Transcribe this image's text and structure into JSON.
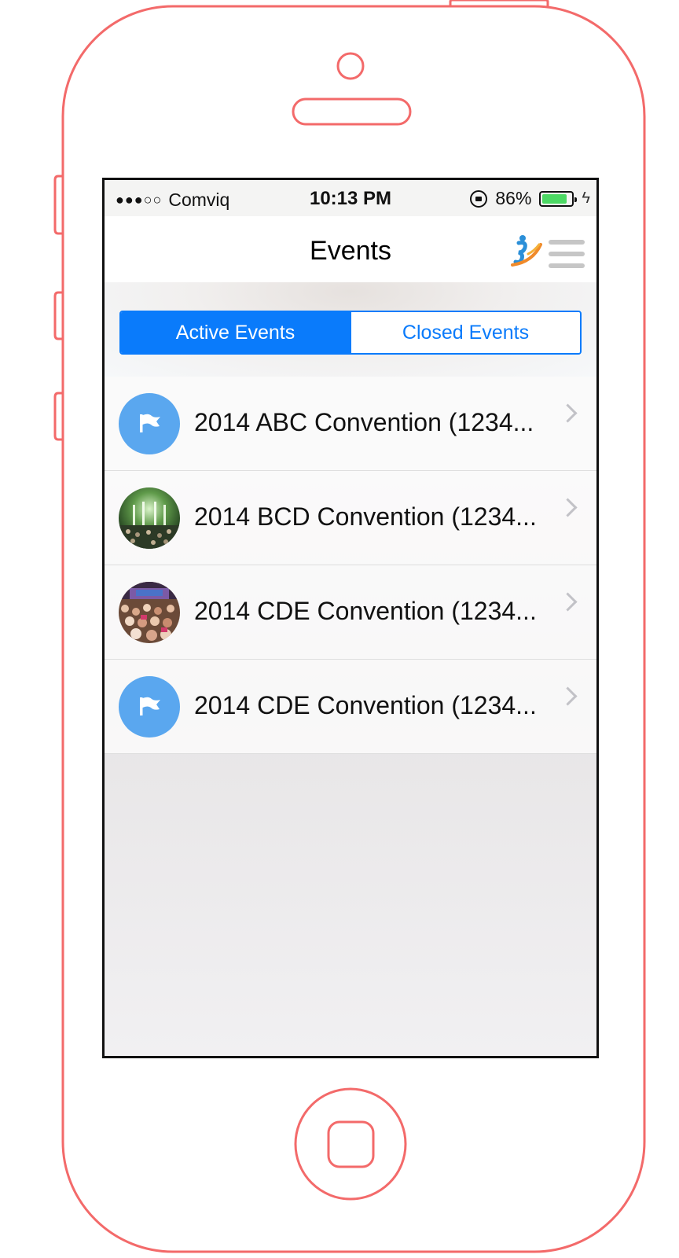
{
  "status_bar": {
    "signal": "●●●○○",
    "carrier": "Comviq",
    "time": "10:13 PM",
    "battery_percent": "86%",
    "battery_level": 0.86,
    "battery_color": "#4cd964"
  },
  "nav": {
    "title": "Events",
    "logo_icon": "app-logo-icon",
    "menu_icon": "hamburger-menu-icon"
  },
  "segments": {
    "active_label": "Active Events",
    "closed_label": "Closed Events",
    "selected": "Active Events",
    "accent_color": "#0a7bfb"
  },
  "events": [
    {
      "title": "2014 ABC Convention (1234...",
      "thumbnail": "flag-icon"
    },
    {
      "title": "2014 BCD Convention (1234...",
      "thumbnail": "stage-photo"
    },
    {
      "title": "2014 CDE Convention (1234...",
      "thumbnail": "crowd-photo"
    },
    {
      "title": "2014 CDE Convention (1234...",
      "thumbnail": "flag-icon"
    }
  ],
  "frame_color": "#f36a6a"
}
